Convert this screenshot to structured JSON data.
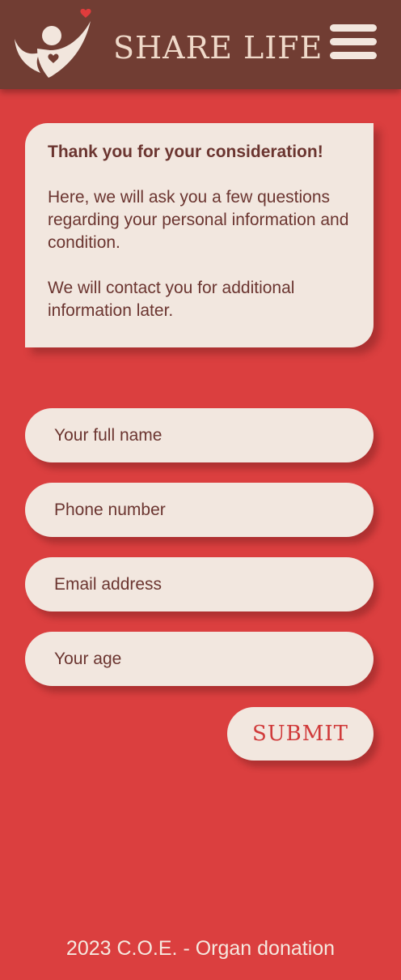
{
  "header": {
    "brand": "SHARE LIFE",
    "logo_icon": "person-heart-logo-icon",
    "menu_icon": "hamburger-menu-icon"
  },
  "intro": {
    "lead": "Thank you for your consideration!",
    "paragraph1": "Here, we will ask you a few questions regarding your personal information and condition.",
    "paragraph2": "We will contact you for additional information later."
  },
  "form": {
    "fields": [
      {
        "placeholder": "Your full name",
        "value": ""
      },
      {
        "placeholder": "Phone number",
        "value": ""
      },
      {
        "placeholder": "Email address",
        "value": ""
      },
      {
        "placeholder": "Your age",
        "value": ""
      }
    ],
    "submit_label": "SUBMIT"
  },
  "footer": {
    "text": "2023 C.O.E. - Organ donation"
  },
  "colors": {
    "page_background": "#db3f3f",
    "header_background": "#713d33",
    "card_background": "#f2e7df",
    "text_brown": "#6b3530",
    "submit_text": "#d03a3a",
    "heart_accent": "#e03c3c"
  }
}
